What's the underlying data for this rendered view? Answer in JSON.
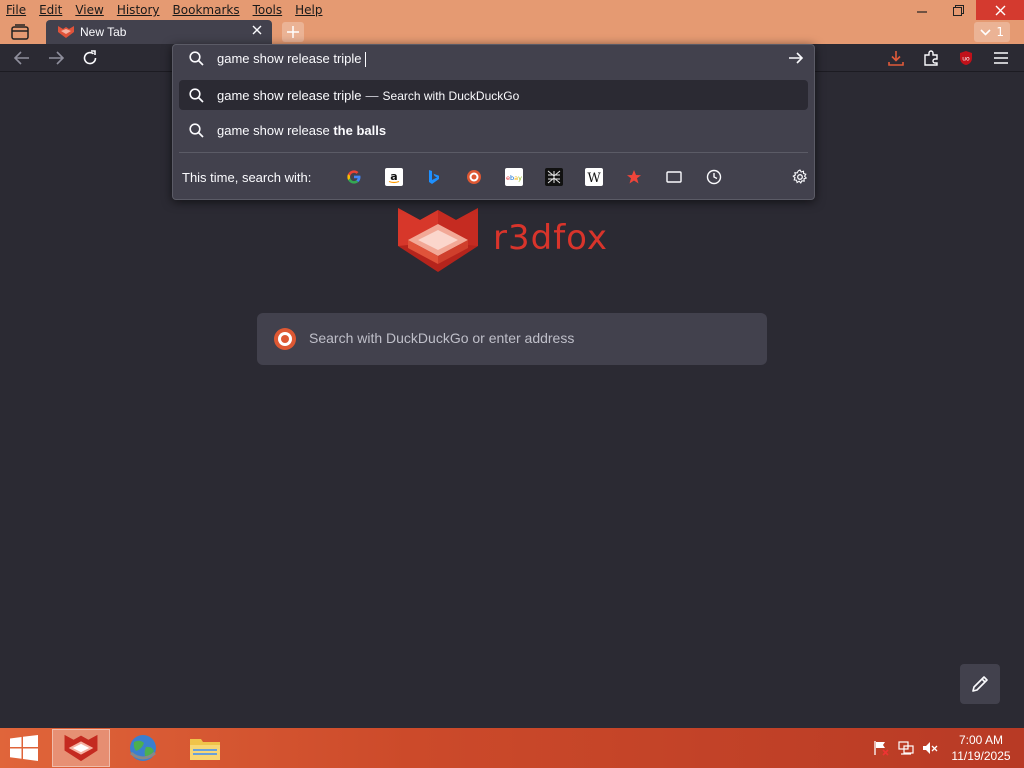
{
  "menubar": {
    "items": [
      "File",
      "Edit",
      "View",
      "History",
      "Bookmarks",
      "Tools",
      "Help"
    ]
  },
  "window_controls": {
    "minimize": "minimize-icon",
    "restore": "restore-icon",
    "close": "close-icon"
  },
  "tab": {
    "title": "New Tab",
    "close_icon": "close-icon"
  },
  "tab_list": {
    "count": "1"
  },
  "urlbar": {
    "value": "game show release triple",
    "suggestions": [
      {
        "prefix": "game show release triple",
        "bold": "",
        "action": "Search with DuckDuckGo"
      },
      {
        "prefix": "game show release ",
        "bold": "the balls",
        "action": ""
      }
    ],
    "one_off_label": "This time, search with:",
    "engines": [
      "Google",
      "Amazon",
      "Bing",
      "DuckDuckGo",
      "eBay",
      "Perplexity",
      "Wikipedia",
      "Bookmarks",
      "Tabs",
      "History"
    ]
  },
  "brand": {
    "name": "r3dfox",
    "color": "#d9342b"
  },
  "content_search": {
    "placeholder": "Search with DuckDuckGo or enter address"
  },
  "taskbar": {
    "apps": [
      "r3dfox",
      "Chromium",
      "File Explorer"
    ],
    "clock_time": "7:00 AM",
    "clock_date": "11/19/2025"
  },
  "colors": {
    "titlebar": "#e59a72",
    "page_bg": "#2b2a33",
    "panel_bg": "#42414d",
    "accent_red": "#d9342b"
  }
}
